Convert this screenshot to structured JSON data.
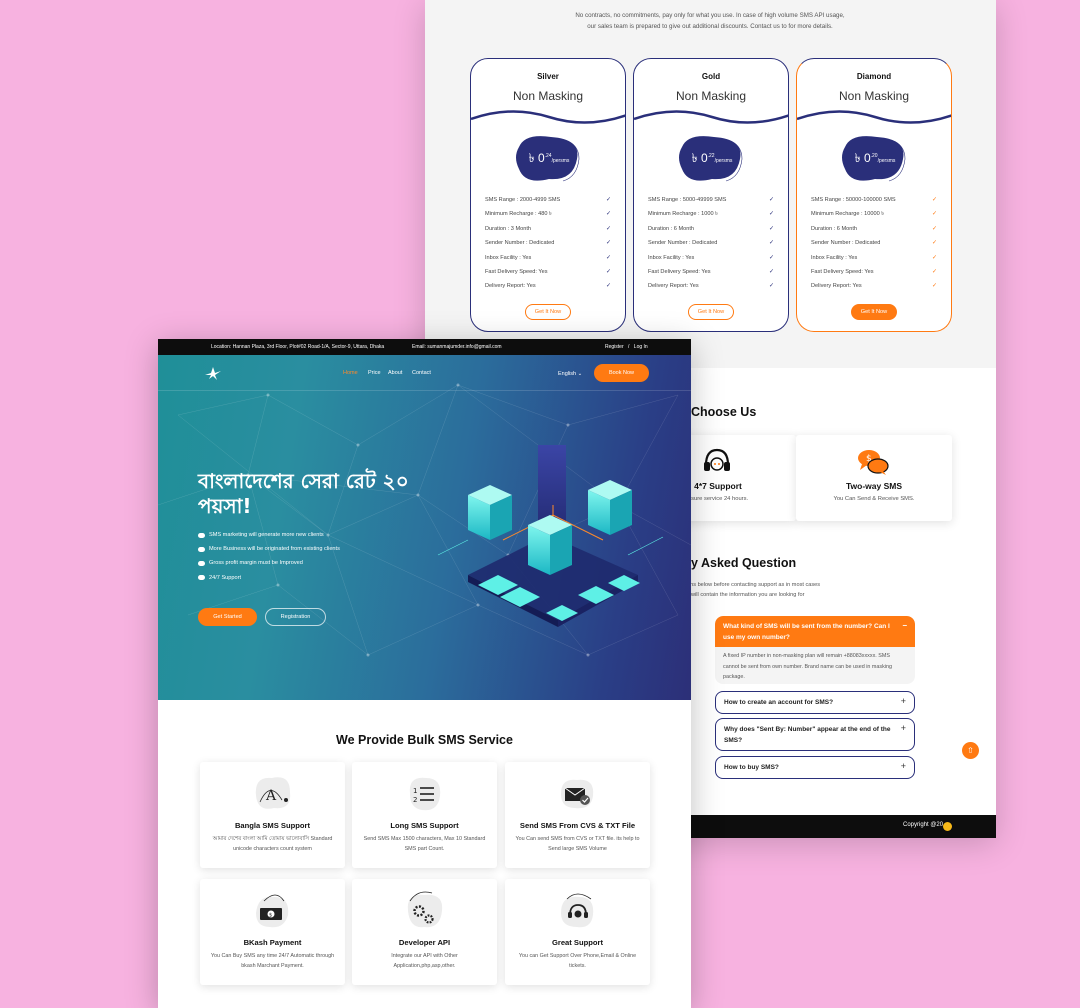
{
  "colors": {
    "accent": "#ff7a12",
    "navy": "#2a2f7a",
    "background": "#f7b2e0",
    "footer": "#0d0d0d"
  },
  "pricing": {
    "description": "No contracts, no commitments, pay only for what you use. In case of high volume SMS API usage, our sales team is prepared to give out additional discounts. Contact us to for more details.",
    "plans": [
      {
        "name": "Silver",
        "type": "Non Masking",
        "currency": "৳",
        "price": "0",
        "fraction": ".24",
        "unit": "/persms",
        "features": [
          "SMS Range : 2000-4999 SMS",
          "Minimum Recharge : 480 ৳",
          "Duration : 3 Month",
          "Sender Number : Dedicated",
          "Inbox Facility : Yes",
          "Fast Delivery Speed: Yes",
          "Delivery Report: Yes"
        ],
        "button": "Get It Now"
      },
      {
        "name": "Gold",
        "type": "Non Masking",
        "currency": "৳",
        "price": "0",
        "fraction": ".22",
        "unit": "/persms",
        "features": [
          "SMS Range : 5000-49999 SMS",
          "Minimum Recharge : 1000 ৳",
          "Duration : 6 Month",
          "Sender Number : Dedicated",
          "Inbox Facility : Yes",
          "Fast Delivery Speed: Yes",
          "Delivery Report: Yes"
        ],
        "button": "Get It Now"
      },
      {
        "name": "Diamond",
        "type": "Non Masking",
        "currency": "৳",
        "price": "0",
        "fraction": ".20",
        "unit": "/persms",
        "features": [
          "SMS Range : 50000-100000 SMS",
          "Minimum Recharge : 10000 ৳",
          "Duration : 6 Month",
          "Sender Number : Dedicated",
          "Inbox Facility : Yes",
          "Fast Delivery Speed: Yes",
          "Delivery Report: Yes"
        ],
        "button": "Get It Now"
      }
    ]
  },
  "why": {
    "title": "Choose Us",
    "cards": [
      {
        "title": "4*7 Support",
        "desc": "nsure service 24 hours.",
        "icon": "headset-icon"
      },
      {
        "title": "Two-way SMS",
        "desc": "You Can Send & Receive SMS.",
        "icon": "chat-bubbles-icon"
      }
    ]
  },
  "faq": {
    "title": "y Asked Question",
    "subtitle_1": "ons below before contacting support as in most cases",
    "subtitle_2": "will contain the information you are looking for",
    "open": {
      "question": "What kind of SMS will be sent from the number? Can I use my own number?",
      "answer": "A fixed IP number in non-masking plan will remain +88083xxxxx. SMS cannot be sent from own number. Brand name can be used in masking package.",
      "symbol": "−"
    },
    "items": [
      {
        "question": "How to create an account for SMS?",
        "symbol": "+"
      },
      {
        "question": "Why does \"Sent By: Number\" appear at the end of the SMS?",
        "symbol": "+"
      },
      {
        "question": "How to buy SMS?",
        "symbol": "+"
      }
    ]
  },
  "back_footer": {
    "copyright": "Copyright @20"
  },
  "topbar": {
    "location": "Location: Hannan Plaza, 3rd Floor, Plot#02 Road-1/A, Sector-9, Uttara, Dhaka",
    "email": "Email: sumanmajumder.info@gmail.com",
    "register": "Register",
    "separator": "/",
    "login": "Log In"
  },
  "nav": {
    "items": [
      "Home",
      "Price",
      "About",
      "Contact"
    ],
    "language": "English",
    "book": "Book Now"
  },
  "hero": {
    "title": "বাংলাদেশের সেরা রেট ২০ পয়সা!",
    "points": [
      "SMS marketing will generate more new clients",
      "More Business will be originated from existing clients",
      "Gross profit margin must be Improved",
      "24/7 Support"
    ],
    "primary_button": "Get Started",
    "secondary_button": "Registration"
  },
  "services": {
    "title": "We Provide Bulk SMS Service",
    "cards": [
      {
        "title": "Bangla SMS Support",
        "desc": "আমার দেশের বাংলা আমি তোমায় ভালোবাসি Standard unicode characters count system",
        "icon": "bangla-letter-icon"
      },
      {
        "title": "Long SMS Support",
        "desc": "Send SMS Max 1500 characters, Max 10 Standard SMS part Count.",
        "icon": "numbered-list-icon"
      },
      {
        "title": "Send SMS From CVS & TXT File",
        "desc": "You Can send SMS from CVS or TXT file. its help to Send large SMS Volume",
        "icon": "envelope-check-icon"
      },
      {
        "title": "BKash Payment",
        "desc": "You Can Buy SMS any time 24/7 Automatic through bkash Marchant Payment.",
        "icon": "banknote-icon"
      },
      {
        "title": "Developer API",
        "desc": "Integrate our API with Other Application,php,asp,other.",
        "icon": "gears-icon"
      },
      {
        "title": "Great Support",
        "desc": "You can Get Support Over Phone,Email & Online tickets.",
        "icon": "support-headset-icon"
      }
    ]
  }
}
